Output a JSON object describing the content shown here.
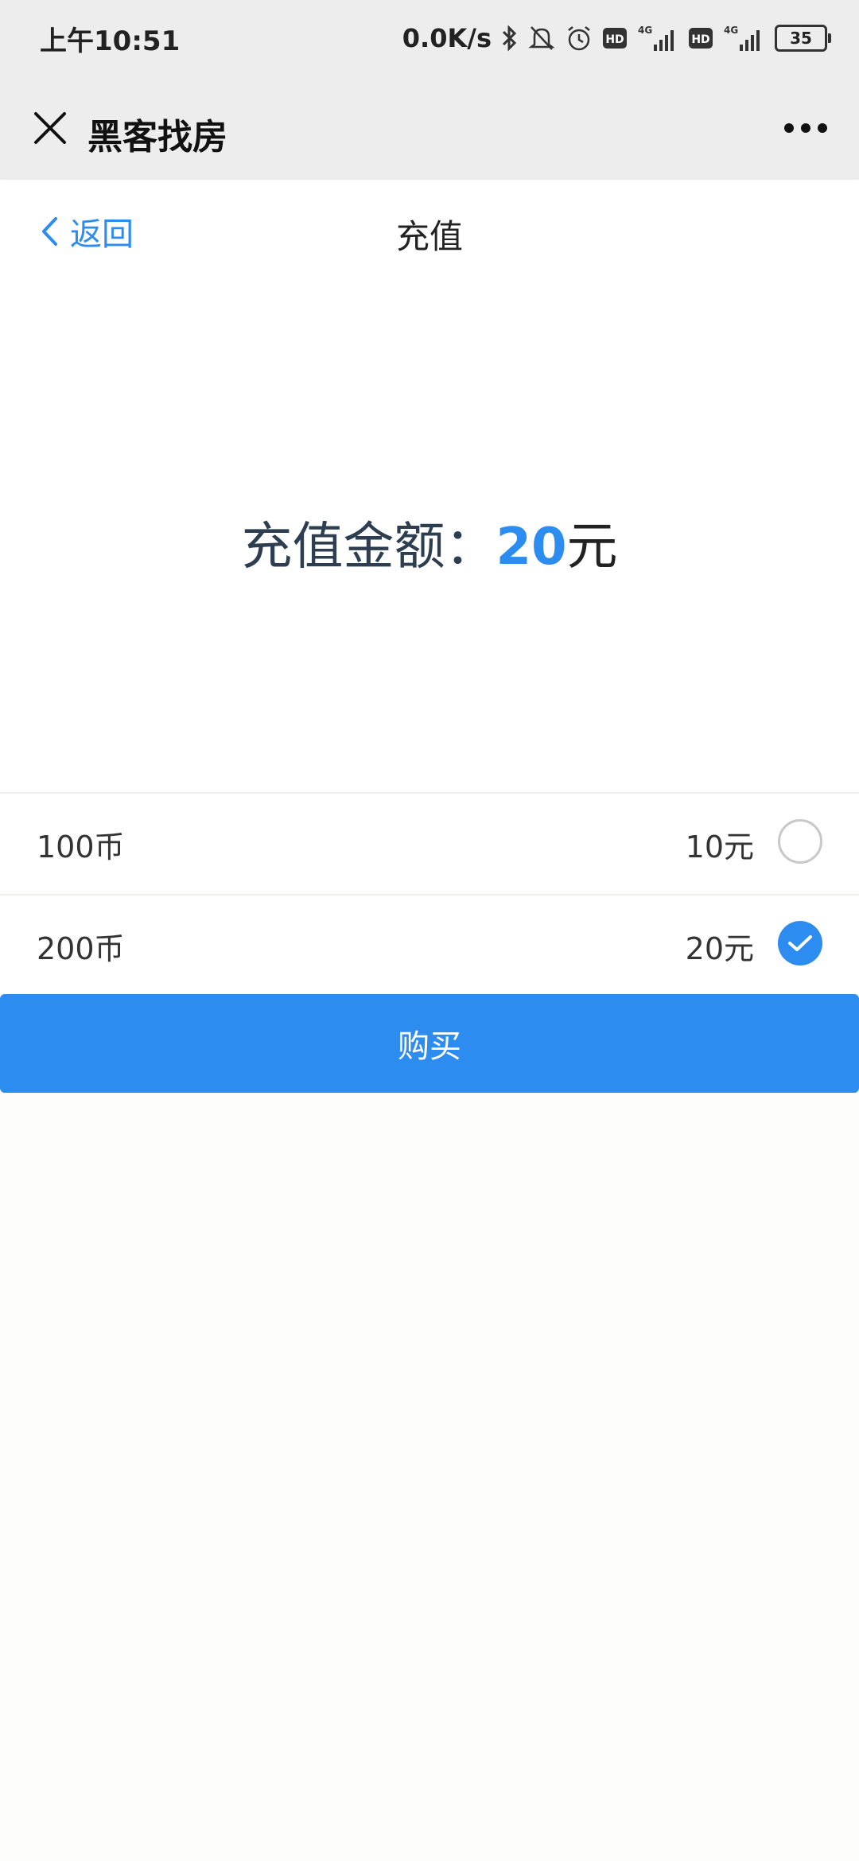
{
  "status_bar": {
    "time": "上午10:51",
    "net_speed": "0.0K/s",
    "battery": "35",
    "icons": [
      "bluetooth-icon",
      "mute-bell-icon",
      "alarm-icon",
      "hd-icon",
      "signal-4g-icon",
      "hd-icon",
      "signal-4g-icon",
      "battery-icon"
    ]
  },
  "title_bar": {
    "title": "黑客找房",
    "close_icon": "close-icon",
    "more_icon": "more-dots-icon"
  },
  "nav": {
    "back_label": "返回",
    "title": "充值"
  },
  "recharge": {
    "label": "充值金额：",
    "value": "20",
    "unit": "元"
  },
  "options": [
    {
      "coins": "100币",
      "price": "10元",
      "selected": false
    },
    {
      "coins": "200币",
      "price": "20元",
      "selected": true
    }
  ],
  "buy_button": "购买",
  "colors": {
    "accent": "#2d8cf0",
    "header_bg": "#ededed",
    "text": "#333333"
  }
}
